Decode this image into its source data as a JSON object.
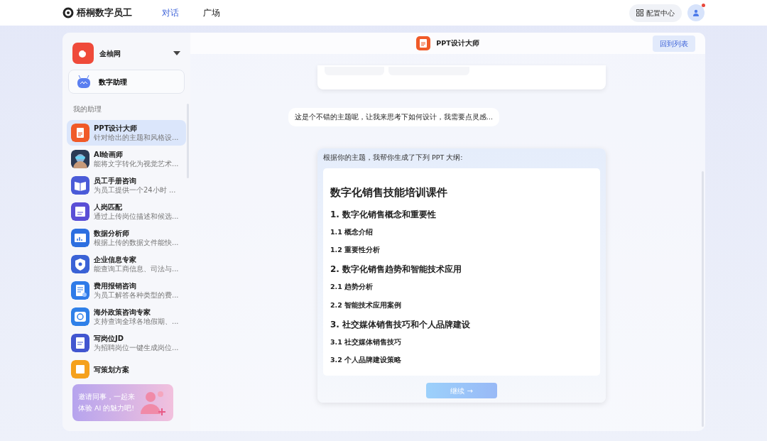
{
  "app": {
    "name": "梧桐数字员工"
  },
  "nav": [
    {
      "label": "对话",
      "selected": true
    },
    {
      "label": "广场",
      "selected": false
    }
  ],
  "header_actions": {
    "config": "配置中心",
    "has_notification": true
  },
  "org": {
    "name": "金柚网"
  },
  "assistant_entry": {
    "label": "数字助理"
  },
  "sidebar": {
    "section": "我的助理",
    "items": [
      {
        "title": "PPT设计大师",
        "desc": "针对给出的主题和风格设...",
        "kind": "ppt",
        "color": "#f05a28",
        "selected": true
      },
      {
        "title": "AI绘画师",
        "desc": "能将文字转化为视觉艺术...",
        "kind": "picture",
        "color": "#2b3a55",
        "selected": false
      },
      {
        "title": "员工手册咨询",
        "desc": "为员工提供一个24小时 ...",
        "kind": "book",
        "color": "#4a5bd8",
        "selected": false
      },
      {
        "title": "人岗匹配",
        "desc": "通过上传岗位描述和候选...",
        "kind": "cv",
        "color": "#5a4fd6",
        "selected": false
      },
      {
        "title": "数据分析师",
        "desc": "根据上传的数据文件能快...",
        "kind": "chart",
        "color": "#2d6fe0",
        "selected": false
      },
      {
        "title": "企业信息专家",
        "desc": "能查询工商信息、司法与...",
        "kind": "shield",
        "color": "#3a62d6",
        "selected": false
      },
      {
        "title": "费用报销咨询",
        "desc": "为员工解答各种类型的费...",
        "kind": "receipt",
        "color": "#2f7be8",
        "selected": false
      },
      {
        "title": "海外政策咨询专家",
        "desc": "支持查询全球各地假期、...",
        "kind": "globe",
        "color": "#2f80e8",
        "selected": false
      },
      {
        "title": "写岗位JD",
        "desc": "为招聘岗位一键生成岗位...",
        "kind": "doc",
        "color": "#4256d0",
        "selected": false
      },
      {
        "title": "写策划方案",
        "kind": "plan",
        "color": "#f5a11c",
        "selected": false
      }
    ]
  },
  "invite": {
    "text": "邀请同事，一起来体验 AI 的魅力吧!"
  },
  "chat": {
    "title": "PPT设计大师",
    "back": "回到列表",
    "message": "这是个不错的主题呢，让我来思考下如何设计，我需要点灵感...",
    "outline_intro": "根据你的主题，我帮你生成了下列 PPT 大纲:",
    "outline": [
      {
        "kind": "title",
        "text": "数字化销售技能培训课件"
      },
      {
        "kind": "section",
        "text": "1. 数字化销售概念和重要性"
      },
      {
        "kind": "sub",
        "text": "1.1 概念介绍"
      },
      {
        "kind": "sub",
        "text": "1.2 重要性分析"
      },
      {
        "kind": "section",
        "text": "2. 数字化销售趋势和智能技术应用"
      },
      {
        "kind": "sub",
        "text": "2.1 趋势分析"
      },
      {
        "kind": "sub",
        "text": "2.2 智能技术应用案例"
      },
      {
        "kind": "section",
        "text": "3. 社交媒体销售技巧和个人品牌建设"
      },
      {
        "kind": "sub",
        "text": "3.1 社交媒体销售技巧"
      },
      {
        "kind": "sub",
        "text": "3.2 个人品牌建设策略"
      }
    ],
    "continue": {
      "label": "继续 →",
      "disabled": true
    }
  }
}
